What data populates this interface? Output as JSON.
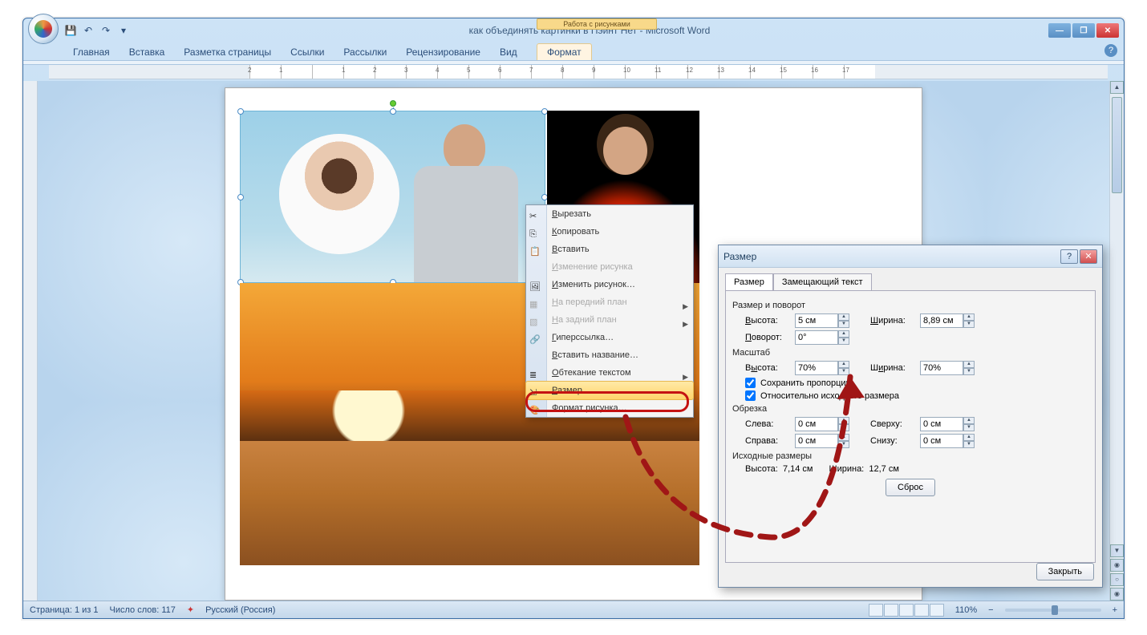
{
  "window": {
    "title": "как объединять картинки в Пэйнт Нет - Microsoft Word",
    "context_tools": "Работа с рисунками"
  },
  "ribbon": {
    "tabs": [
      "Главная",
      "Вставка",
      "Разметка страницы",
      "Ссылки",
      "Рассылки",
      "Рецензирование",
      "Вид"
    ],
    "context_tab": "Формат"
  },
  "ruler_ticks": [
    "2",
    "1",
    "",
    "1",
    "2",
    "3",
    "4",
    "5",
    "6",
    "7",
    "8",
    "9",
    "10",
    "11",
    "12",
    "13",
    "14",
    "15",
    "16",
    "17"
  ],
  "context_menu": {
    "items": [
      {
        "label": "Вырезать",
        "icon": "cut-icon",
        "disabled": false
      },
      {
        "label": "Копировать",
        "icon": "copy-icon",
        "disabled": false
      },
      {
        "label": "Вставить",
        "icon": "paste-icon",
        "disabled": false
      },
      {
        "label": "Изменение рисунка",
        "icon": "",
        "disabled": true
      },
      {
        "label": "Изменить рисунок…",
        "icon": "edit-picture-icon",
        "disabled": false
      },
      {
        "label": "На передний план",
        "icon": "bring-front-icon",
        "disabled": true,
        "arrow": true
      },
      {
        "label": "На задний план",
        "icon": "send-back-icon",
        "disabled": true,
        "arrow": true
      },
      {
        "label": "Гиперссылка…",
        "icon": "hyperlink-icon",
        "disabled": false
      },
      {
        "label": "Вставить название…",
        "icon": "",
        "disabled": false
      },
      {
        "label": "Обтекание текстом",
        "icon": "wrap-text-icon",
        "disabled": false,
        "arrow": true
      },
      {
        "label": "Размер…",
        "icon": "size-icon",
        "disabled": false,
        "selected": true
      },
      {
        "label": "Формат рисунка…",
        "icon": "format-picture-icon",
        "disabled": false
      }
    ]
  },
  "dialog": {
    "title": "Размер",
    "tabs": [
      "Размер",
      "Замещающий текст"
    ],
    "group_size_rotate": "Размер и поворот",
    "height_label": "Высота:",
    "height_value": "5 см",
    "width_label": "Ширина:",
    "width_value": "8,89 см",
    "rotate_label": "Поворот:",
    "rotate_value": "0°",
    "group_scale": "Масштаб",
    "scale_h_label": "Высота:",
    "scale_h_value": "70%",
    "scale_w_label": "Ширина:",
    "scale_w_value": "70%",
    "lock_aspect": "Сохранить пропорции",
    "relative_orig": "Относительно исходного размера",
    "group_crop": "Обрезка",
    "crop_left_l": "Слева:",
    "crop_left_v": "0 см",
    "crop_top_l": "Сверху:",
    "crop_top_v": "0 см",
    "crop_right_l": "Справа:",
    "crop_right_v": "0 см",
    "crop_bottom_l": "Снизу:",
    "crop_bottom_v": "0 см",
    "group_orig": "Исходные размеры",
    "orig_h_l": "Высота:",
    "orig_h_v": "7,14 см",
    "orig_w_l": "Ширина:",
    "orig_w_v": "12,7 см",
    "reset": "Сброс",
    "close": "Закрыть"
  },
  "status": {
    "page": "Страница: 1 из 1",
    "words": "Число слов: 117",
    "lang": "Русский (Россия)",
    "zoom": "110%"
  }
}
